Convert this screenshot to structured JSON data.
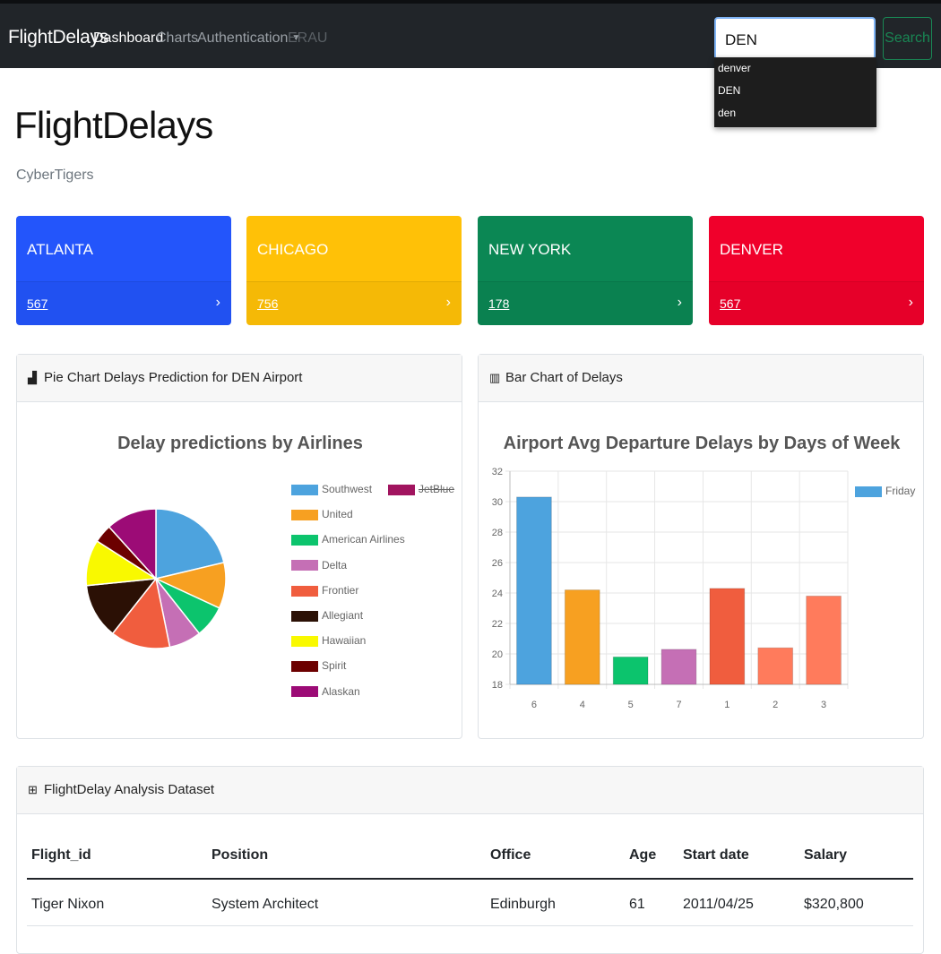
{
  "nav": {
    "brand": "FlightDelays",
    "links": [
      {
        "label": "Dashboard"
      },
      {
        "label": "Charts"
      },
      {
        "label": "Authentication"
      },
      {
        "label": "ERAU"
      }
    ],
    "search_value": "DEN",
    "search_button": "Search",
    "suggestions": [
      "denver",
      "DEN",
      "den"
    ]
  },
  "header": {
    "title": "FlightDelays",
    "subtitle": "CyberTigers"
  },
  "cards": [
    {
      "name": "ATLANTA",
      "value": "567",
      "color": "#2355fb"
    },
    {
      "name": "CHICAGO",
      "value": "756",
      "color": "#ffc107"
    },
    {
      "name": "NEW YORK",
      "value": "178",
      "color": "#0b8754"
    },
    {
      "name": "DENVER",
      "value": "567",
      "color": "#f0002b"
    }
  ],
  "pie_panel": {
    "heading": "Pie Chart Delays Prediction for DEN Airport"
  },
  "bar_panel": {
    "heading": "Bar Chart of Delays"
  },
  "table_panel": {
    "heading": "FlightDelay Analysis Dataset",
    "columns": [
      "Flight_id",
      "Position",
      "Office",
      "Age",
      "Start date",
      "Salary"
    ],
    "rows": [
      [
        "Tiger Nixon",
        "System Architect",
        "Edinburgh",
        "61",
        "2011/04/25",
        "$320,800"
      ]
    ]
  },
  "chart_data": [
    {
      "type": "pie",
      "title": "Delay predictions by Airlines",
      "legend_position": "right",
      "labels": [
        "Southwest",
        "JetBlue",
        "United",
        "American Airlines",
        "Delta",
        "Frontier",
        "Allegiant",
        "Hawaiian",
        "Spirit",
        "Alaskan"
      ],
      "values": [
        20,
        0,
        10,
        7,
        7,
        13,
        12,
        10,
        4,
        11
      ],
      "colors": [
        "#4da3de",
        "#a1145f",
        "#f7a021",
        "#0cc46d",
        "#c56fb5",
        "#f05d3e",
        "#2b1005",
        "#f9f900",
        "#6c0000",
        "#9c0b76"
      ],
      "hidden": [
        "JetBlue"
      ]
    },
    {
      "type": "bar",
      "title": "Airport Avg Departure Delays by Days of Week",
      "categories": [
        "6",
        "4",
        "5",
        "7",
        "1",
        "2",
        "3"
      ],
      "series": [
        {
          "name": "Friday",
          "values": [
            30.3,
            24.2,
            19.8,
            20.3,
            24.3,
            20.4,
            23.8
          ]
        }
      ],
      "colors": [
        "#4da3de",
        "#f7a021",
        "#0cc46d",
        "#c56fb5",
        "#f05d3e",
        "#ff7b5c",
        "#ff7b5c"
      ],
      "ylim": [
        18,
        32
      ],
      "yticks": [
        18,
        20,
        22,
        24,
        26,
        28,
        30,
        32
      ],
      "grid": true,
      "legend_position": "right"
    }
  ]
}
